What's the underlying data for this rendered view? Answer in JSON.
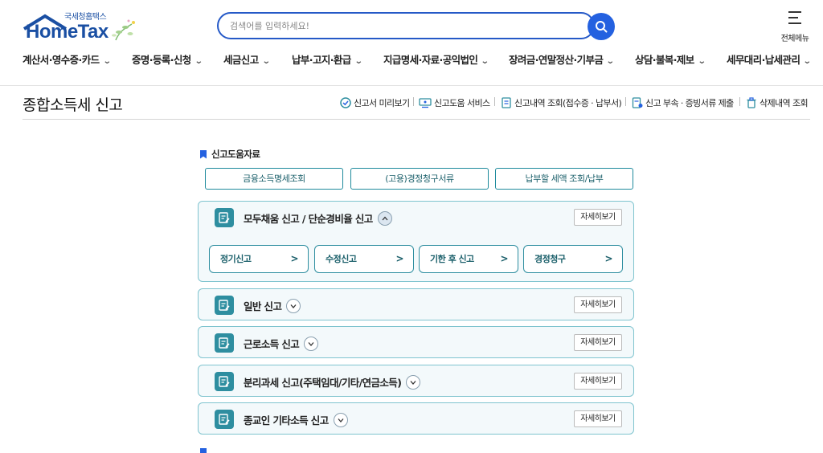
{
  "header": {
    "logo_sub": "국세청홈택스",
    "logo_main": "HomeTax",
    "search_placeholder": "검색어를 입력하세요!",
    "all_menu_label": "전체메뉴"
  },
  "nav": [
    {
      "label": "계산서·영수증·카드"
    },
    {
      "label": "증명·등록·신청"
    },
    {
      "label": "세금신고"
    },
    {
      "label": "납부·고지·환급"
    },
    {
      "label": "지급명세·자료·공익법인"
    },
    {
      "label": "장려금·연말정산·기부금"
    },
    {
      "label": "상담·불복·제보"
    },
    {
      "label": "세무대리·납세관리"
    }
  ],
  "page": {
    "title": "종합소득세 신고",
    "utility_links": [
      {
        "label": "신고서 미리보기",
        "icon": "check-circle-icon"
      },
      {
        "label": "신고도움 서비스",
        "icon": "monitor-icon"
      },
      {
        "label": "신고내역 조회(접수증 · 납부서)",
        "icon": "document-icon"
      },
      {
        "label": "신고 부속 · 증빙서류 제출",
        "icon": "document-upload-icon"
      },
      {
        "label": "삭제내역 조회",
        "icon": "trash-icon"
      }
    ]
  },
  "help_section": {
    "title": "신고도움자료",
    "buttons": [
      {
        "label": "금융소득명세조회"
      },
      {
        "label": "(고용)경정청구서류"
      },
      {
        "label": "납부할 세액 조회/납부"
      }
    ]
  },
  "cards": [
    {
      "title": "모두채움 신고 / 단순경비율 신고",
      "detail_label": "자세히보기",
      "expanded": true,
      "sub_buttons": [
        {
          "label": "정기신고"
        },
        {
          "label": "수정신고"
        },
        {
          "label": "기한 후 신고"
        },
        {
          "label": "경정청구"
        }
      ]
    },
    {
      "title": "일반 신고",
      "detail_label": "자세히보기",
      "expanded": false
    },
    {
      "title": "근로소득 신고",
      "detail_label": "자세히보기",
      "expanded": false
    },
    {
      "title": "분리과세 신고(주택임대/기타/연금소득)",
      "detail_label": "자세히보기",
      "expanded": false
    },
    {
      "title": "종교인 기타소득 신고",
      "detail_label": "자세히보기",
      "expanded": false
    }
  ],
  "colors": {
    "brand_blue": "#1a4fa3",
    "accent_blue": "#2461e0",
    "teal": "#2e8ea0"
  }
}
